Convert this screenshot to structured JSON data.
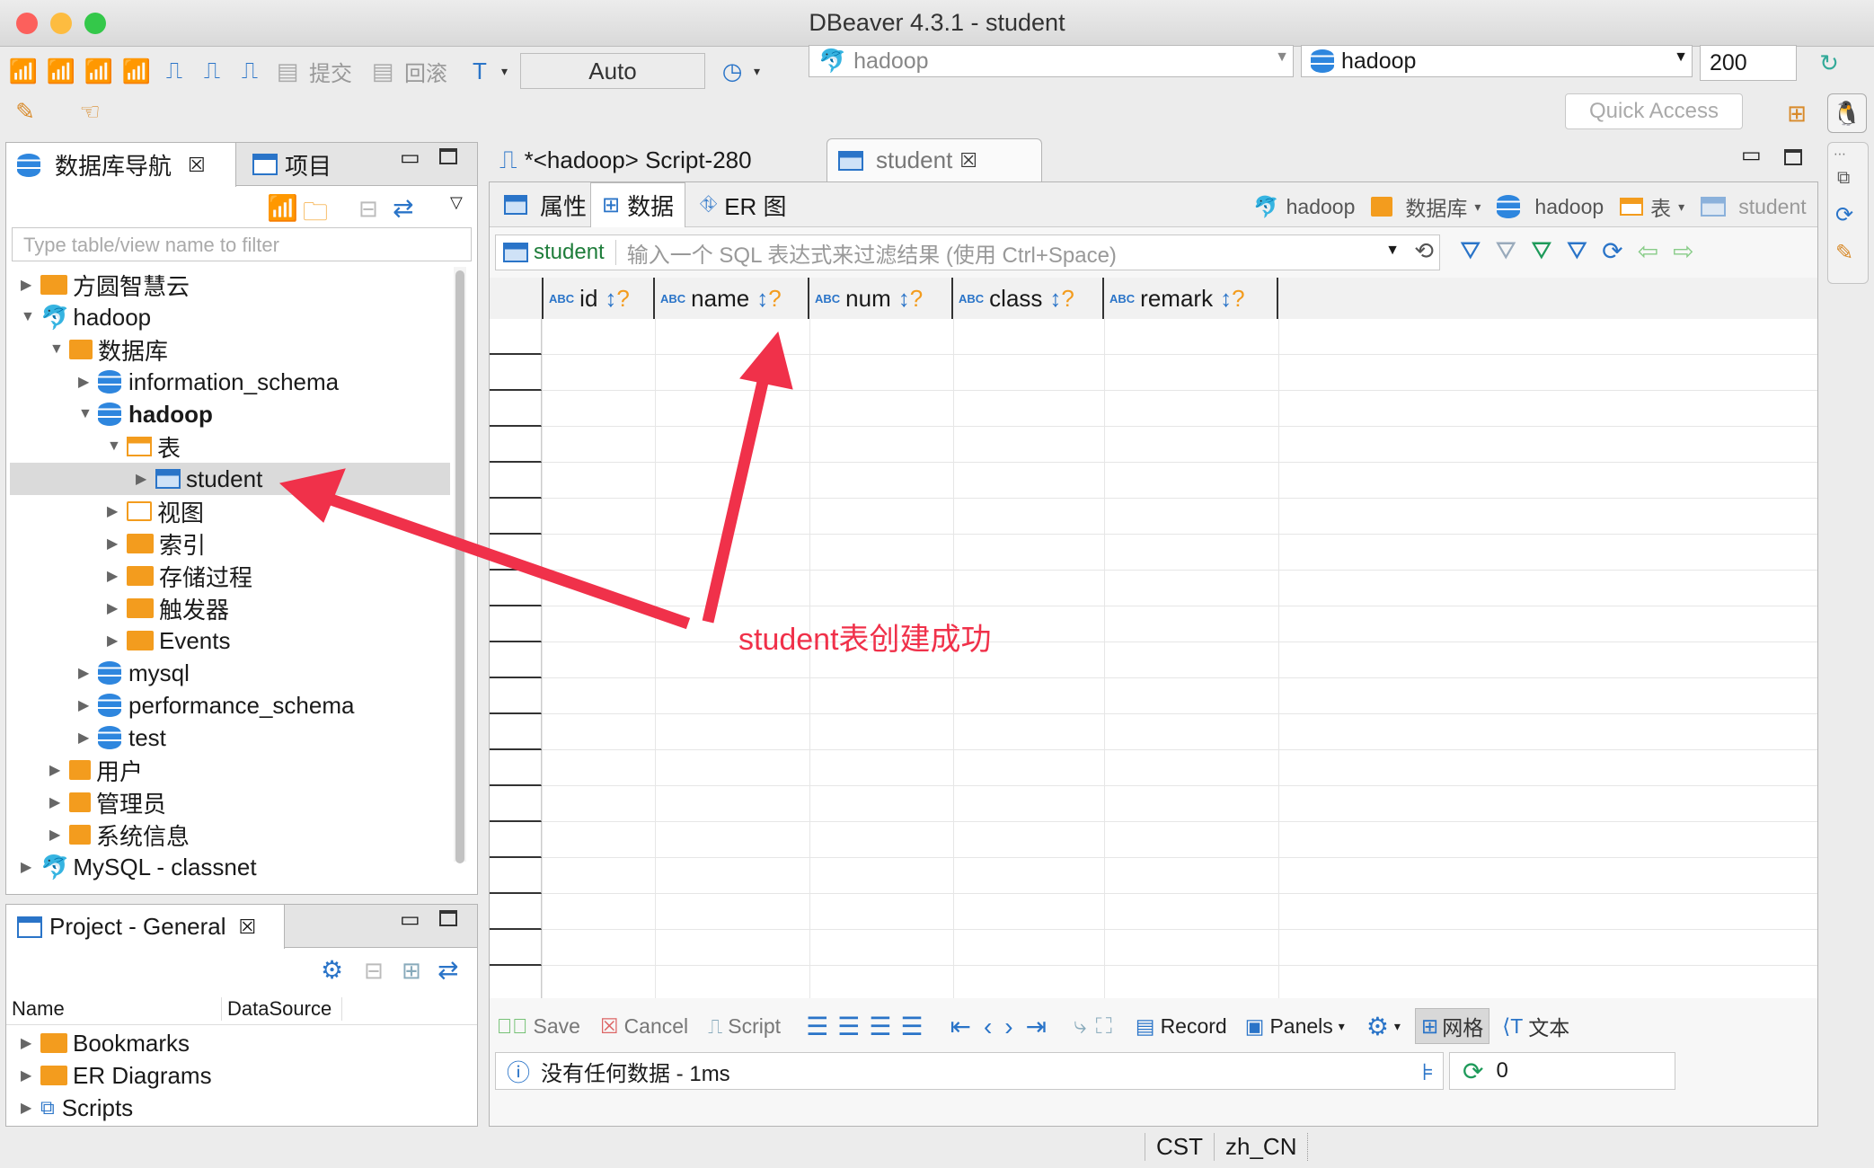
{
  "window": {
    "title": "DBeaver 4.3.1 - student"
  },
  "toolbar": {
    "commit_label": "提交",
    "rollback_label": "回滚",
    "auto_commit": "Auto",
    "connection_combo": "hadoop",
    "database_combo": "hadoop",
    "fetch_size": "200",
    "quick_access": "Quick Access"
  },
  "navigator": {
    "tab_label": "数据库导航",
    "project_tab_label": "项目",
    "filter_placeholder": "Type table/view name to filter",
    "tree": [
      {
        "label": "方圆智慧云"
      },
      {
        "label": "hadoop"
      },
      {
        "label": "数据库"
      },
      {
        "label": "information_schema"
      },
      {
        "label": "hadoop"
      },
      {
        "label": "表"
      },
      {
        "label": "student"
      },
      {
        "label": "视图"
      },
      {
        "label": "索引"
      },
      {
        "label": "存储过程"
      },
      {
        "label": "触发器"
      },
      {
        "label": "Events"
      },
      {
        "label": "mysql"
      },
      {
        "label": "performance_schema"
      },
      {
        "label": "test"
      },
      {
        "label": "用户"
      },
      {
        "label": "管理员"
      },
      {
        "label": "系统信息"
      },
      {
        "label": "MySQL - classnet"
      }
    ]
  },
  "project_panel": {
    "tab_label": "Project - General",
    "col_name": "Name",
    "col_datasource": "DataSource",
    "items": [
      {
        "label": "Bookmarks"
      },
      {
        "label": "ER Diagrams"
      },
      {
        "label": "Scripts"
      }
    ]
  },
  "editor": {
    "tabs": [
      {
        "label": "*<hadoop> Script-280"
      },
      {
        "label": "student"
      }
    ],
    "subtabs": [
      {
        "label": "属性"
      },
      {
        "label": "数据"
      },
      {
        "label": "ER 图"
      }
    ],
    "breadcrumb": {
      "conn": "hadoop",
      "db_label": "数据库",
      "schema": "hadoop",
      "table_label": "表",
      "table": "student"
    },
    "filter_table": "student",
    "filter_placeholder": "输入一个 SQL 表达式来过滤结果 (使用 Ctrl+Space)",
    "columns": [
      {
        "name": "id"
      },
      {
        "name": "name"
      },
      {
        "name": "num"
      },
      {
        "name": "class"
      },
      {
        "name": "remark"
      }
    ],
    "abc_tag": "ABC",
    "sort_glyph": "↕",
    "sort_q": "?"
  },
  "results_toolbar": {
    "save": "Save",
    "cancel": "Cancel",
    "script": "Script",
    "record": "Record",
    "panels": "Panels",
    "grid": "网格",
    "text": "文本"
  },
  "status": {
    "message": "没有任何数据 - 1ms",
    "refresh_count": "0",
    "timezone": "CST",
    "locale": "zh_CN"
  },
  "annotation": {
    "text": "student表创建成功",
    "color": "#f0314a"
  }
}
